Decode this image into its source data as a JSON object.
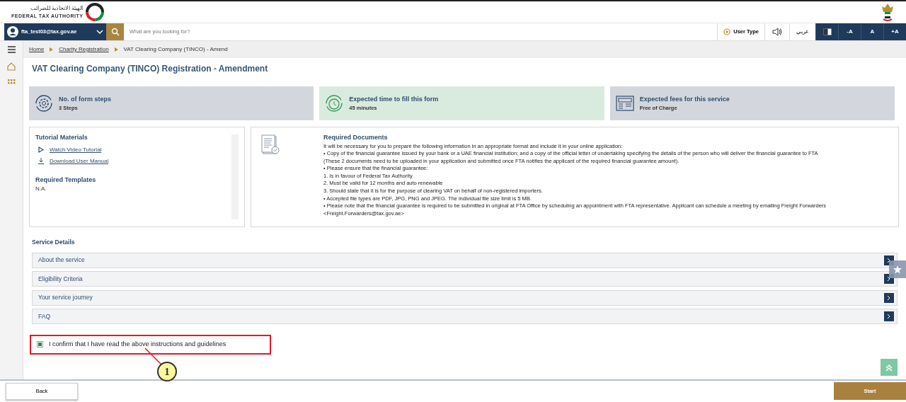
{
  "header": {
    "logo_arabic": "الهيئة الاتحادية للضرائب",
    "logo_english": "FEDERAL TAX AUTHORITY"
  },
  "toolbar": {
    "user": "fta_test03@tax.gov.ae",
    "search_placeholder": "What are you looking for?",
    "user_type": "User Type",
    "language": "عربي",
    "font_buttons": [
      "-A",
      "A",
      "+A"
    ]
  },
  "breadcrumb": [
    {
      "label": "Home",
      "link": true
    },
    {
      "label": "Charity Registration",
      "link": true
    },
    {
      "label": "VAT Clearing Company (TINCO) - Amend",
      "link": false
    }
  ],
  "page_title": "VAT Clearing Company (TINCO) Registration - Amendment",
  "info_cards": [
    {
      "kind": "steps",
      "title": "No. of form steps",
      "value": "3 Steps",
      "highlighted": false
    },
    {
      "kind": "time",
      "title": "Expected time to fill this form",
      "value": "45 minutes",
      "highlighted": true
    },
    {
      "kind": "fees",
      "title": "Expected fees for this service",
      "value": "Free of Charge",
      "highlighted": false
    }
  ],
  "tutorial": {
    "title": "Tutorial Materials",
    "links": [
      {
        "kind": "video",
        "label": "Watch Video Tutorial"
      },
      {
        "kind": "download",
        "label": "Download User Manual"
      }
    ],
    "templates_title": "Required Templates",
    "templates_value": "N.A."
  },
  "required_documents": {
    "title": "Required Documents",
    "lines": [
      "It will be necessary for you to prepare the following information in an appropriate format and include it in your online application:",
      "• Copy of the financial guarantee issued by your bank or a UAE financial institution; and a copy of the official letter of undertaking specifying the details of the person who will deliver the financial guarantee to FTA",
      "(These 2 documents need to be uploaded in your application and submitted once  FTA notifies the applicant of the required financial guarantee amount).",
      "• Please ensure that the financial guarantee:",
      "1. Is in favour of Federal Tax Authority",
      "2. Must be valid for 12 months and auto renewable",
      "3. Should state that it is for the purpose of clearing VAT on behalf of non-registered importers.",
      "• Accepted file types are PDF, JPG, PNG and JPEG. The individual file size limit is 5 MB.",
      "• Please note that the financial guarantee is required to be submitted in original at FTA Office by scheduling an appointment with FTA representative. Applicant can schedule a meeting by emailing Freight Forwarders",
      "<Freight.Forwarders@tax.gov.ae>"
    ]
  },
  "service_details": {
    "title": "Service Details",
    "sections": [
      {
        "label": "About the service",
        "expanded": false
      },
      {
        "label": "Eligibility Criteria",
        "expanded": false
      },
      {
        "label": "Your service journey",
        "expanded": false
      },
      {
        "label": "FAQ",
        "expanded": false
      }
    ]
  },
  "confirm": {
    "label": "I confirm that I have read the above instructions and guidelines",
    "checked": true
  },
  "callout": {
    "number": "1"
  },
  "footer": {
    "back": "Back",
    "start": "Start"
  }
}
